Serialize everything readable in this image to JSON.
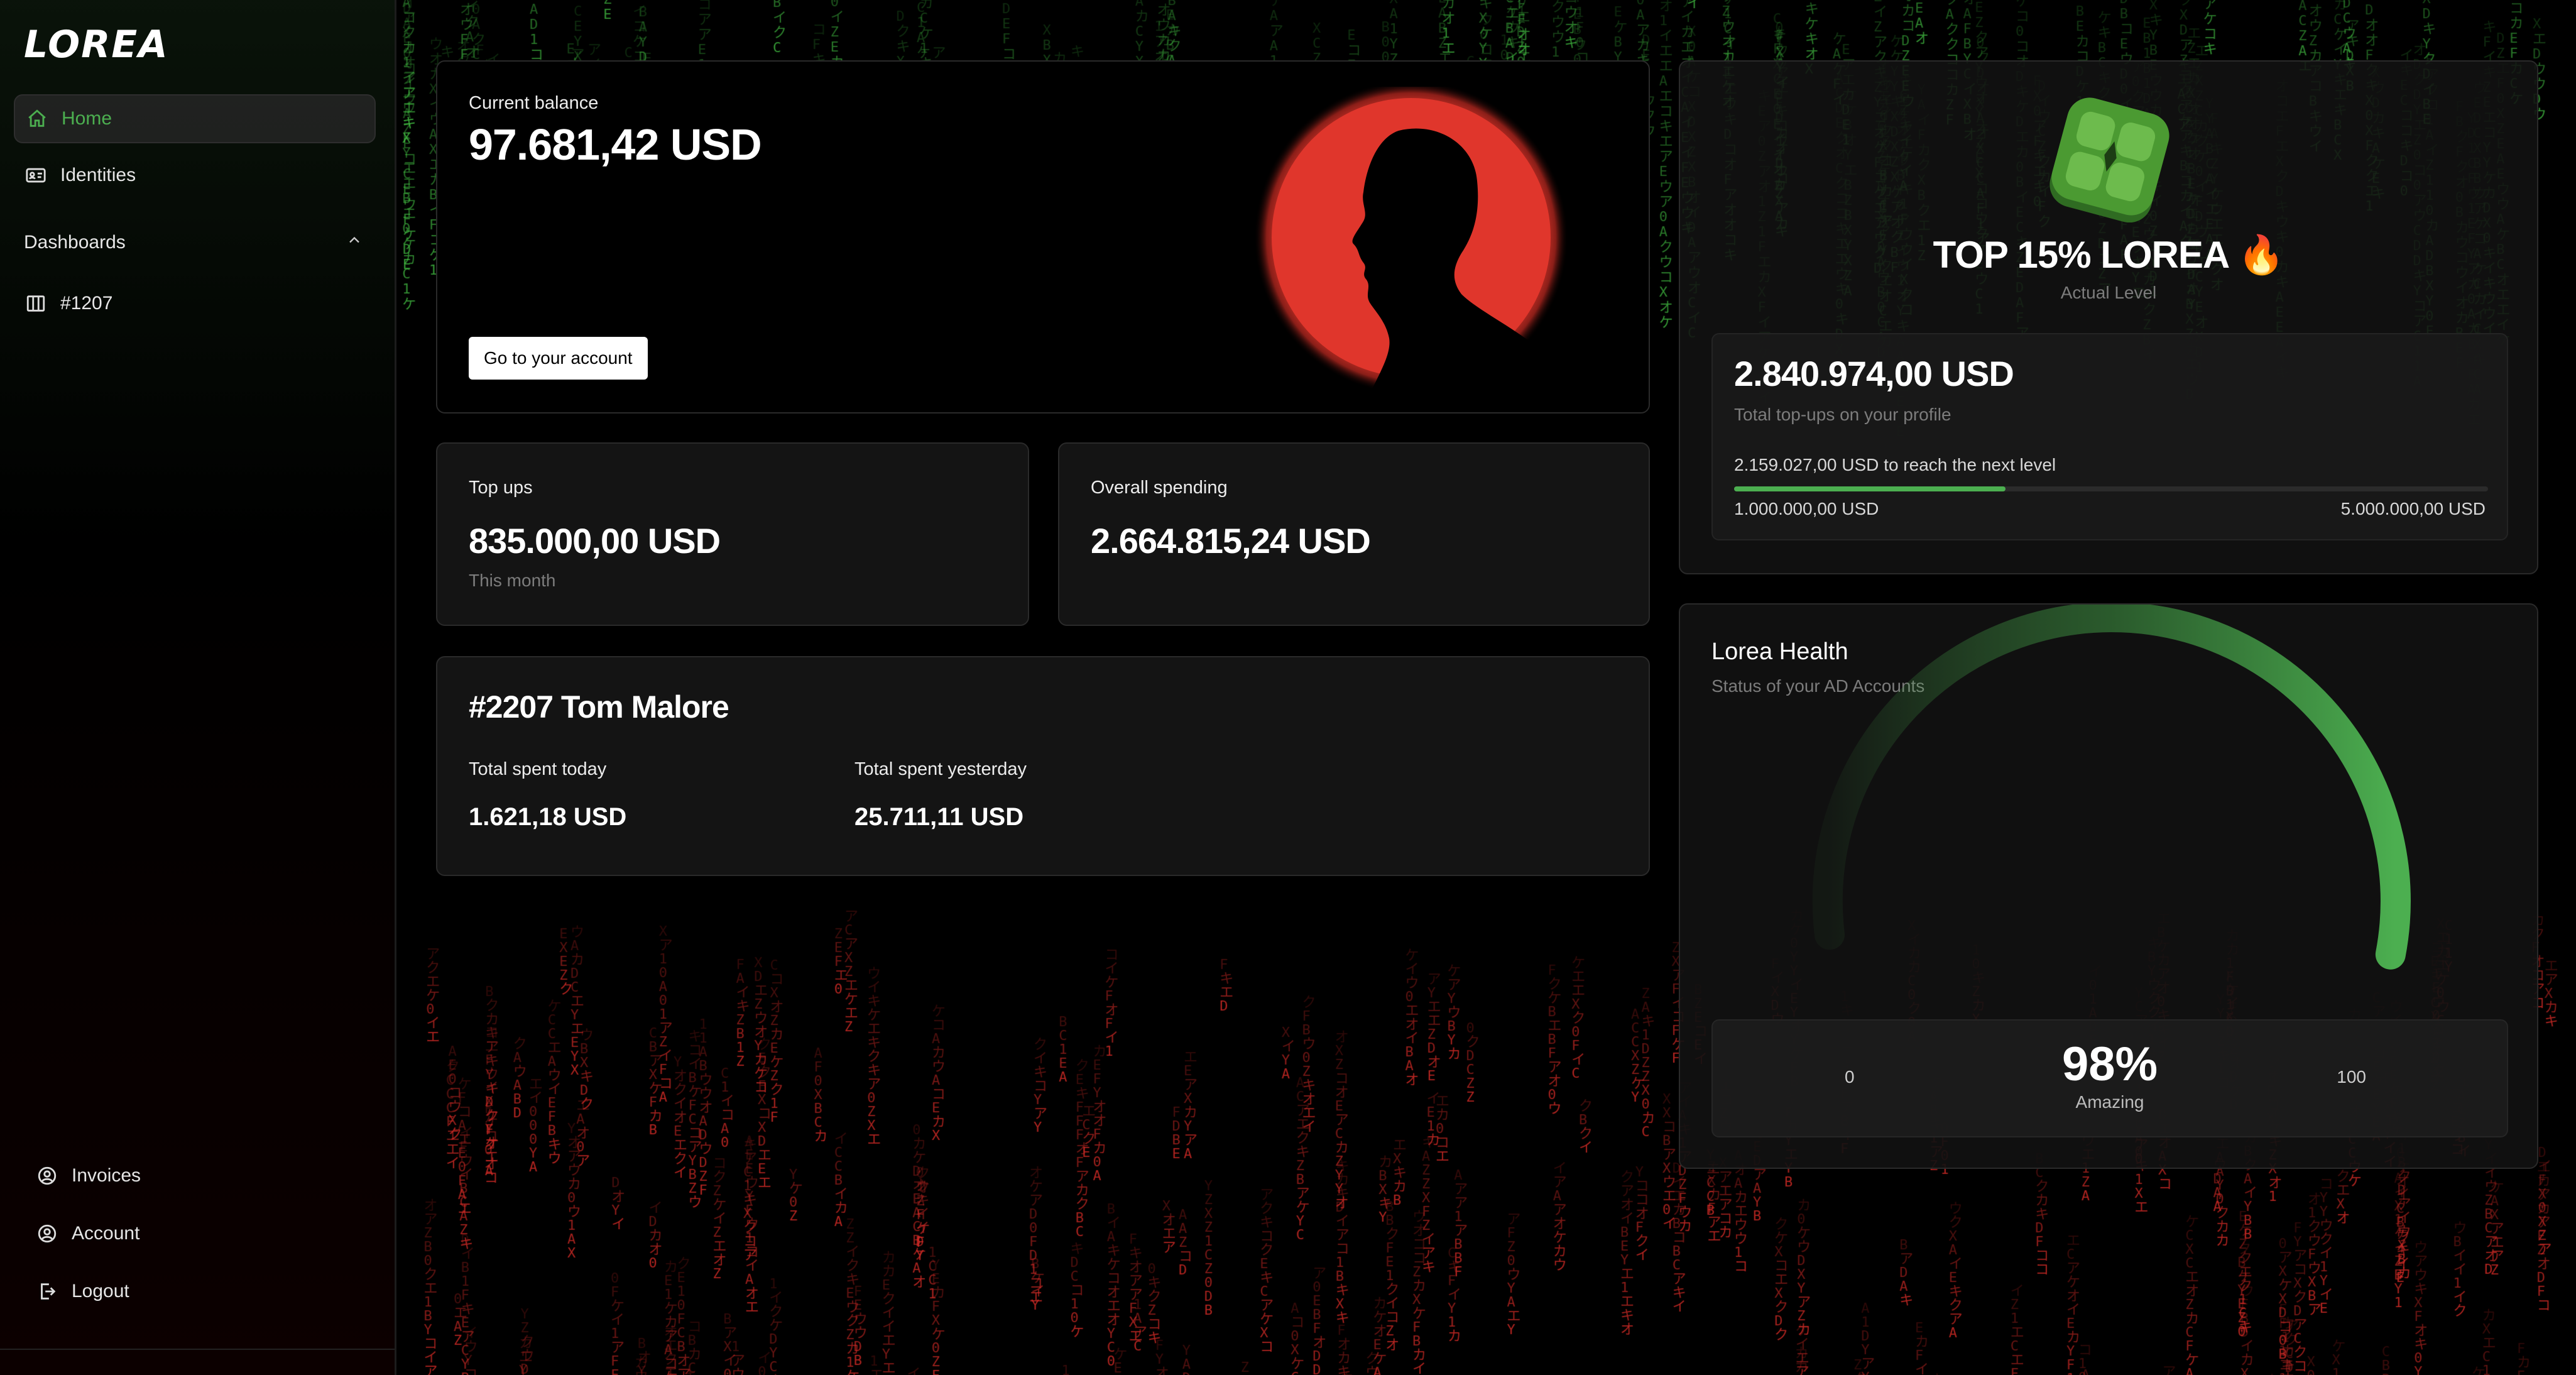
{
  "app": {
    "logo": "LOREA"
  },
  "sidebar": {
    "items": [
      {
        "label": "Home",
        "icon": "home-icon",
        "active": true
      },
      {
        "label": "Identities",
        "icon": "id-card-icon",
        "active": false
      }
    ],
    "section": {
      "label": "Dashboards",
      "icon": "chevron-up-icon",
      "items": [
        {
          "label": "#1207",
          "icon": "columns-icon"
        }
      ]
    },
    "bottom": [
      {
        "label": "Invoices",
        "icon": "user-circle-icon"
      },
      {
        "label": "Account",
        "icon": "user-circle-icon"
      },
      {
        "label": "Logout",
        "icon": "logout-icon"
      }
    ]
  },
  "balance": {
    "label": "Current balance",
    "value": "97.681,42 USD",
    "button": "Go to your account"
  },
  "topups": {
    "label": "Top ups",
    "value": "835.000,00 USD",
    "sub": "This month"
  },
  "spending": {
    "label": "Overall spending",
    "value": "2.664.815,24 USD"
  },
  "user": {
    "title": "#2207 Tom Malore",
    "today_label": "Total spent today",
    "today_value": "1.621,18 USD",
    "yesterday_label": "Total spent yesterday",
    "yesterday_value": "25.711,11 USD"
  },
  "level": {
    "title": "TOP 15% LOREA",
    "emoji": "🔥",
    "subtitle": "Actual Level",
    "total": "2.840.974,00 USD",
    "total_label": "Total top-ups on your profile",
    "next_level": "2.159.027,00 USD to reach the next level",
    "min": "1.000.000,00 USD",
    "max": "5.000.000,00 USD",
    "progress_fraction": 0.36
  },
  "health": {
    "title": "Lorea Health",
    "subtitle": "Status of your AD Accounts",
    "min": "0",
    "max": "100",
    "value": "98%",
    "value_number": 98,
    "status": "Amazing"
  },
  "colors": {
    "accent": "#4caf50",
    "red": "#e0362c",
    "bg": "#000000"
  }
}
